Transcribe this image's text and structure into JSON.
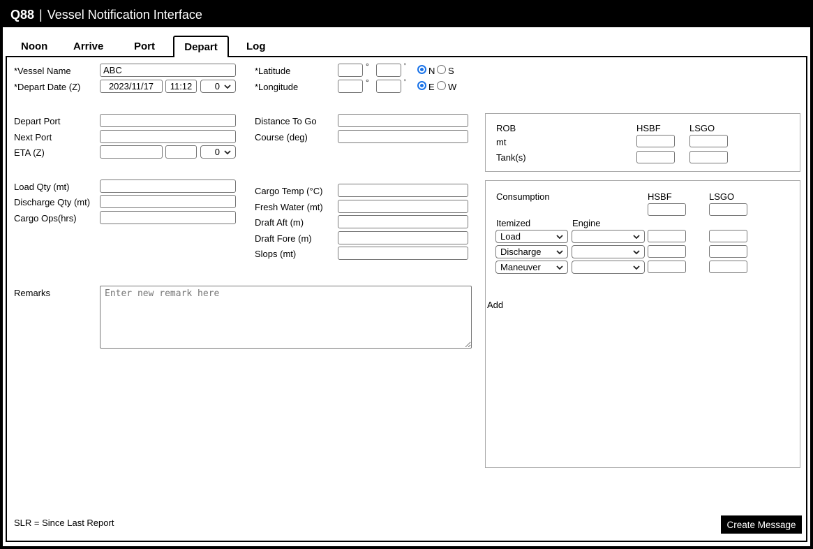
{
  "header": {
    "brand": "Q88",
    "separator": "|",
    "title": "Vessel Notification Interface"
  },
  "tabs": [
    {
      "label": "Noon",
      "active": false
    },
    {
      "label": "Arrive",
      "active": false
    },
    {
      "label": "Port",
      "active": false
    },
    {
      "label": "Depart",
      "active": true
    },
    {
      "label": "Log",
      "active": false
    }
  ],
  "form": {
    "vessel_name": {
      "label": "*Vessel Name",
      "value": "ABC"
    },
    "depart_date": {
      "label": "*Depart Date (Z)",
      "date": "2023/11/17",
      "time": "11:12",
      "tz": "0"
    },
    "latitude": {
      "label": "*Latitude",
      "deg": "",
      "min": "",
      "deg_unit": "°",
      "min_unit": "'",
      "options": [
        "N",
        "S"
      ],
      "selected": "N"
    },
    "longitude": {
      "label": "*Longitude",
      "deg": "",
      "min": "",
      "deg_unit": "°",
      "min_unit": "'",
      "options": [
        "E",
        "W"
      ],
      "selected": "E"
    },
    "depart_port": {
      "label": "Depart Port",
      "value": ""
    },
    "next_port": {
      "label": "Next Port",
      "value": ""
    },
    "eta": {
      "label": "ETA (Z)",
      "date": "",
      "time": "",
      "tz": "0"
    },
    "distance_to_go": {
      "label": "Distance To Go",
      "value": ""
    },
    "course": {
      "label": "Course (deg)",
      "value": ""
    },
    "load_qty": {
      "label": "Load Qty (mt)",
      "value": ""
    },
    "discharge_qty": {
      "label": "Discharge Qty (mt)",
      "value": ""
    },
    "cargo_ops": {
      "label": "Cargo Ops(hrs)",
      "value": ""
    },
    "cargo_temp": {
      "label": "Cargo Temp (°C)",
      "value": ""
    },
    "fresh_water": {
      "label": "Fresh Water (mt)",
      "value": ""
    },
    "draft_aft": {
      "label": "Draft Aft (m)",
      "value": ""
    },
    "draft_fore": {
      "label": "Draft Fore (m)",
      "value": ""
    },
    "slops": {
      "label": "Slops (mt)",
      "value": ""
    },
    "remarks": {
      "label": "Remarks",
      "placeholder": "Enter new remark here",
      "value": ""
    }
  },
  "rob": {
    "title": "ROB",
    "col1": "HSBF",
    "col2": "LSGO",
    "rows": [
      {
        "label": "mt",
        "hsbf": "",
        "lsgo": ""
      },
      {
        "label": "Tank(s)",
        "hsbf": "",
        "lsgo": ""
      }
    ]
  },
  "consumption": {
    "title": "Consumption",
    "col1": "HSBF",
    "col2": "LSGO",
    "total_hsbf": "",
    "total_lsgo": "",
    "itemized_header": "Itemized",
    "engine_header": "Engine",
    "rows": [
      {
        "itemized": "Load",
        "engine": "",
        "hsbf": "",
        "lsgo": ""
      },
      {
        "itemized": "Discharge",
        "engine": "",
        "hsbf": "",
        "lsgo": ""
      },
      {
        "itemized": "Maneuver",
        "engine": "",
        "hsbf": "",
        "lsgo": ""
      }
    ],
    "add_label": "Add"
  },
  "footer": {
    "note": "SLR = Since Last Report",
    "create_label": "Create Message"
  },
  "colors": {
    "header_bg": "#000000",
    "header_text": "#ffffff",
    "radio_selected": "#1a73e8",
    "button_bg": "#000000",
    "button_text": "#ffffff"
  }
}
